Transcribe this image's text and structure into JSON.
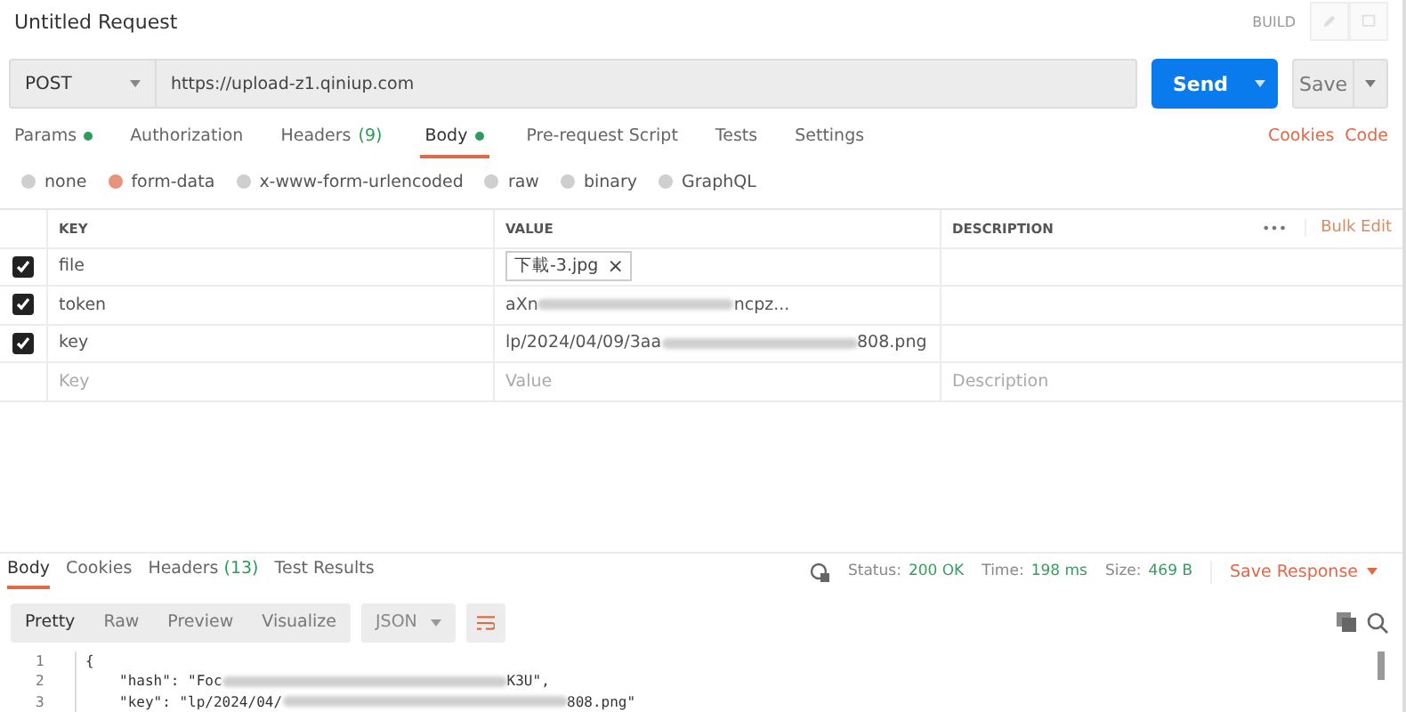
{
  "request": {
    "title": "Untitled Request",
    "mode": "BUILD",
    "method": "POST",
    "url": "https://upload-z1.qiniup.com",
    "send": "Send",
    "save": "Save"
  },
  "tabs": [
    {
      "label": "Params",
      "selected": false,
      "indicator": true
    },
    {
      "label": "Authorization",
      "selected": false,
      "indicator": false
    },
    {
      "label": "Headers",
      "count": "(9)",
      "selected": false,
      "indicator": false
    },
    {
      "label": "Body",
      "selected": true,
      "indicator": true
    },
    {
      "label": "Pre-request Script",
      "selected": false,
      "indicator": false
    },
    {
      "label": "Tests",
      "selected": false,
      "indicator": false
    },
    {
      "label": "Settings",
      "selected": false,
      "indicator": false
    }
  ],
  "links": [
    "Cookies",
    "Code"
  ],
  "body_types": [
    {
      "label": "none",
      "selected": false
    },
    {
      "label": "form-data",
      "selected": true
    },
    {
      "label": "x-www-form-urlencoded",
      "selected": false
    },
    {
      "label": "raw",
      "selected": false
    },
    {
      "label": "binary",
      "selected": false
    },
    {
      "label": "GraphQL",
      "selected": false
    }
  ],
  "table": {
    "columns": [
      "KEY",
      "VALUE",
      "DESCRIPTION"
    ],
    "more": "•••",
    "bulk_edit": "Bulk Edit",
    "rows": [
      {
        "checked": true,
        "key": "file",
        "kind": "file",
        "value_segments": [
          "下載-3.jpg"
        ],
        "remove": "×"
      },
      {
        "checked": true,
        "key": "token",
        "kind": "text",
        "value_segments": [
          "aXn",
          "ncpz..."
        ]
      },
      {
        "checked": true,
        "key": "key",
        "kind": "text",
        "value_segments": [
          "lp/2024/04/09/3aa",
          "808.png"
        ]
      }
    ],
    "new_row": {
      "key_placeholder": "Key",
      "value_placeholder": "Value",
      "description_placeholder": "Description"
    }
  },
  "response": {
    "tabs": [
      {
        "label": "Body",
        "selected": true
      },
      {
        "label": "Cookies",
        "selected": false
      },
      {
        "label": "Headers",
        "count": "(13)",
        "selected": false
      },
      {
        "label": "Test Results",
        "selected": false
      }
    ],
    "status_label": "Status:",
    "status": "200 OK",
    "time_label": "Time:",
    "time": "198 ms",
    "size_label": "Size:",
    "size": "469 B",
    "save": "Save Response",
    "views": [
      {
        "label": "Pretty",
        "selected": true
      },
      {
        "label": "Raw",
        "selected": false
      },
      {
        "label": "Preview",
        "selected": false
      },
      {
        "label": "Visualize",
        "selected": false
      }
    ],
    "format": "JSON",
    "lines": [
      {
        "number": "1",
        "kind": "brace",
        "segments": [
          "{"
        ]
      },
      {
        "number": "2",
        "kind": "member",
        "segments": [
          "\"hash\": \"Foc",
          "K3U\","
        ]
      },
      {
        "number": "3",
        "kind": "member",
        "segments": [
          "\"key\": \"lp/2024/04/",
          "808.png\""
        ]
      }
    ]
  }
}
